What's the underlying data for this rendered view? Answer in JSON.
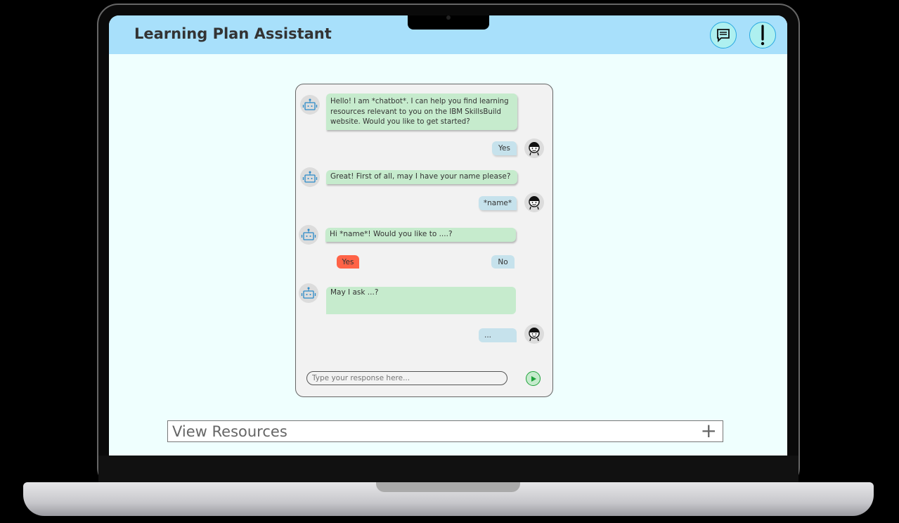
{
  "header": {
    "title": "Learning Plan Assistant",
    "icons": [
      "chat-icon",
      "alert-icon"
    ]
  },
  "chat": {
    "messages": [
      {
        "from": "bot",
        "text": "Hello! I am *chatbot*. I can help you find learning resources relevant to you on the IBM SkillsBuild website. Would you like to get started?"
      },
      {
        "from": "user",
        "text": "Yes"
      },
      {
        "from": "bot",
        "text": "Great! First of all,  may I have your name please?"
      },
      {
        "from": "user",
        "text": "*name*"
      },
      {
        "from": "bot",
        "text": "Hi *name*! Would you like to ....?"
      },
      {
        "from": "bot",
        "text": "May I ask ...?"
      },
      {
        "from": "user",
        "text": "..."
      }
    ],
    "options": {
      "yes": "Yes",
      "no": "No"
    },
    "input_placeholder": "Type your response here...",
    "colors": {
      "bot_bubble": "#c6ebcd",
      "user_bubble": "#c6e2ec",
      "yes_option": "#ff6347"
    }
  },
  "resources": {
    "label": "View Resources",
    "expand_icon": "+"
  }
}
